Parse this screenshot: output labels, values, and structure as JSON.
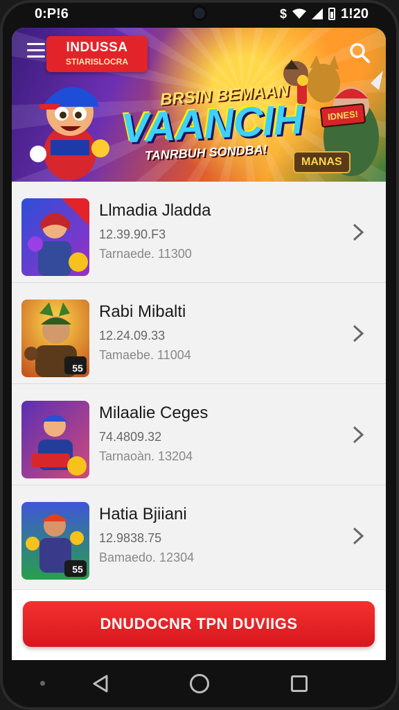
{
  "status_bar": {
    "time": "0:P!6",
    "clock_right": "1!20"
  },
  "header": {
    "brand_title": "INDUSSA",
    "brand_subtitle": "STIARISLOCRA",
    "hero_top": "BRSIN BEMAAN",
    "hero_main": "VAANCIH",
    "hero_sub": "TANRBUH SONDBA!",
    "sticker_tag": "IDNES!",
    "sticker_badge": "MANAS"
  },
  "list": {
    "items": [
      {
        "title": "Llmadia Jladda",
        "date": "12.39.90.F3",
        "size": "Tarnaede. 11300",
        "thumb_badge": ""
      },
      {
        "title": "Rabi Mibalti",
        "date": "12.24.09.33",
        "size": "Tamaebe. 11004",
        "thumb_badge": "55"
      },
      {
        "title": "Milaalie Ceges",
        "date": "74.4809.32",
        "size": "Tarnaoàn. 13204",
        "thumb_badge": ""
      },
      {
        "title": "Hatia Bjiiani",
        "date": "12.9838.75",
        "size": "Bamaedo. 12304",
        "thumb_badge": "55"
      }
    ]
  },
  "download": {
    "label": "DNUDOCNR TPN DUVIIGS"
  },
  "colors": {
    "accent_red": "#e3232a",
    "list_bg": "#f2f2f2"
  },
  "icons": [
    "menu-icon",
    "search-icon",
    "chevron-right-icon",
    "wifi-icon",
    "signal-icon",
    "battery-icon",
    "back-icon",
    "home-icon",
    "recent-apps-icon"
  ]
}
